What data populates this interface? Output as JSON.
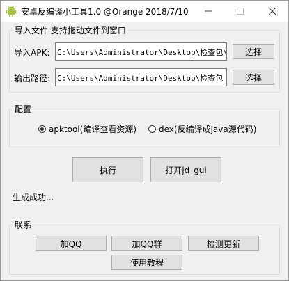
{
  "window": {
    "title": "安卓反编译小工具1.0 @Orange 2018/7/10"
  },
  "import_group": {
    "label": "导入文件 支持拖动文件到窗口",
    "apk_label": "导入APK:",
    "apk_value": "C:\\Users\\Administrator\\Desktop\\检查包\\yyl",
    "apk_choose": "选择",
    "out_label": "输出路径:",
    "out_value": "C:\\Users\\Administrator\\Desktop\\检查包",
    "out_choose": "选择"
  },
  "config_group": {
    "label": "配置",
    "options": [
      {
        "label": "apktool(编译查看资源)",
        "selected": true
      },
      {
        "label": "dex(反编译成java源代码)",
        "selected": false
      }
    ]
  },
  "actions": {
    "run": "执行",
    "open_jdgui": "打开jd_gui"
  },
  "status": "生成成功...",
  "contact_group": {
    "label": "联系",
    "add_qq": "加QQ",
    "add_qq_group": "加QQ群",
    "check_update": "检测更新",
    "tutorial": "使用教程"
  },
  "colors": {
    "android_green": "#a4c639"
  }
}
